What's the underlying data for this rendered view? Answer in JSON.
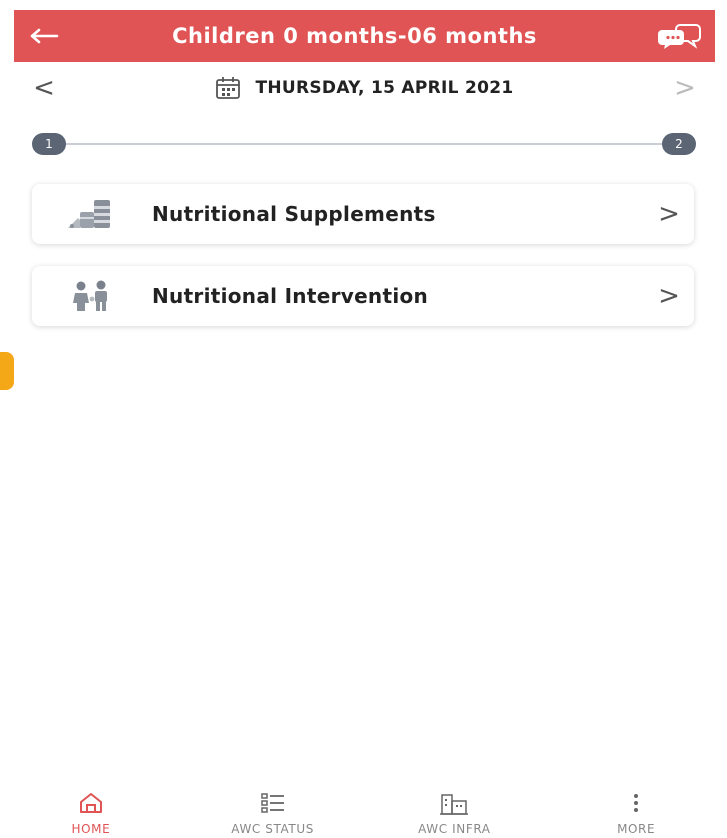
{
  "header": {
    "title": "Children 0 months-06 months",
    "bg_color": "#e05455",
    "back_icon": "arrow-left-icon",
    "chat_icon": "chat-bubbles-icon"
  },
  "date_bar": {
    "prev_symbol": "<",
    "date": "THURSDAY, 15 APRIL 2021",
    "next_symbol": ">",
    "calendar_icon": "calendar-icon"
  },
  "stepper": {
    "step1": "1",
    "step2": "2"
  },
  "cards": [
    {
      "label": "Nutritional Supplements",
      "icon": "supplements-icon",
      "chevron": ">"
    },
    {
      "label": "Nutritional Intervention",
      "icon": "mother-child-icon",
      "chevron": ">"
    }
  ],
  "bottom_nav": [
    {
      "label": "HOME",
      "icon": "home-icon",
      "active": true
    },
    {
      "label": "AWC STATUS",
      "icon": "list-icon",
      "active": false
    },
    {
      "label": "AWC INFRA",
      "icon": "building-icon",
      "active": false
    },
    {
      "label": "MORE",
      "icon": "more-vertical-icon",
      "active": false
    }
  ],
  "colors": {
    "accent": "#e05455",
    "step": "#5b6574",
    "edge_marker": "#f4a817"
  }
}
